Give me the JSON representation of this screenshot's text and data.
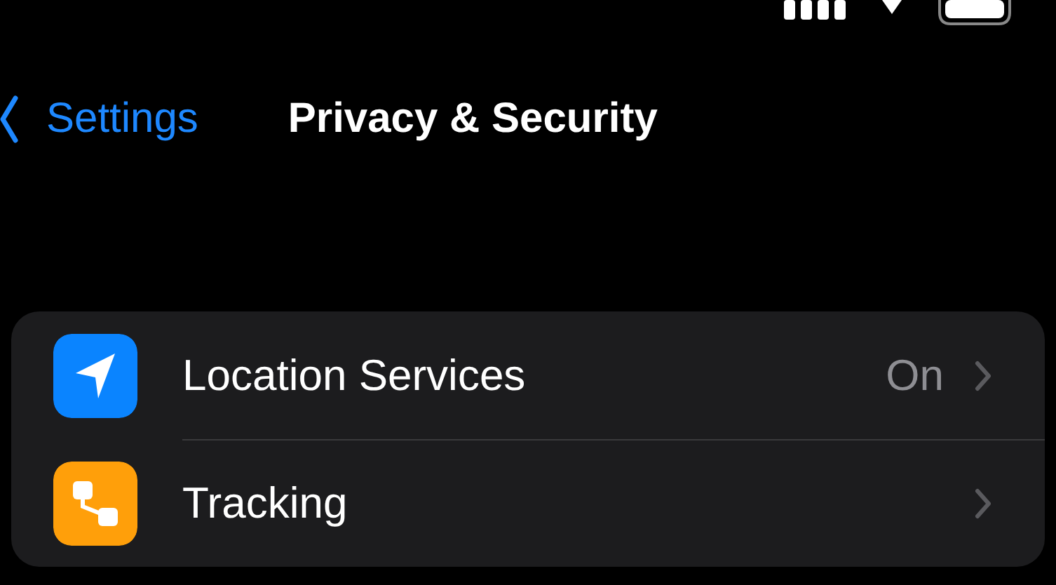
{
  "nav": {
    "back_label": "Settings",
    "title": "Privacy & Security"
  },
  "rows": [
    {
      "label": "Location Services",
      "value": "On",
      "kind": "location",
      "color": "#0a84ff"
    },
    {
      "label": "Tracking",
      "kind": "tracking",
      "color": "#ff9f0a"
    }
  ]
}
